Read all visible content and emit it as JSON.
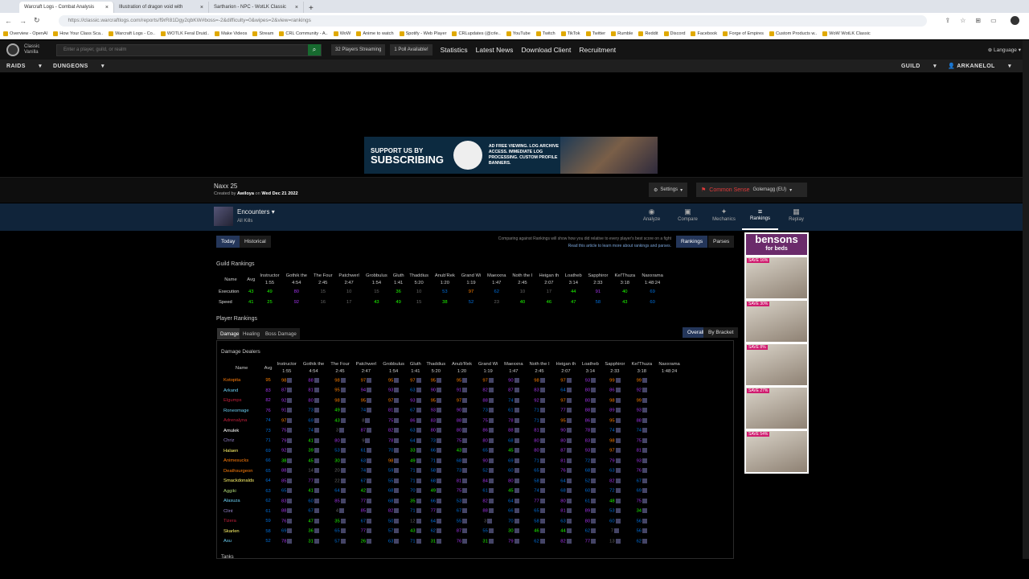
{
  "browser": {
    "tabs": [
      "Warcraft Logs - Combat Analysis",
      "Illustration of dragon void with",
      "Sartharion - NPC - WotLK Classic"
    ],
    "url": "https://classic.warcraftlogs.com/reports/f9rR81Dgy2qbKW#boss=-2&difficulty=0&wipes=2&view=rankings",
    "bookmarks": [
      "Overview - OpenAI",
      "How Your Class Sca..",
      "Warcraft Logs - Co..",
      "WOTLK Feral Druid..",
      "Make Videos",
      "Stream",
      "CRL Community - A..",
      "WoW",
      "Anime to watch",
      "Spotify - Web Player",
      "CRLupdates (@crle..",
      "YouTube",
      "Twitch",
      "TikTok",
      "Twitter",
      "Rumble",
      "Reddit",
      "Discord",
      "Facebook",
      "Forge of Empires",
      "Custom Products w..",
      "WoW WotLK Classic"
    ]
  },
  "site": {
    "version": [
      "Classic",
      "Vanilla"
    ],
    "search_placeholder": "Enter a player, guild, or realm",
    "streaming": "32 Players Streaming",
    "poll": "1 Poll Available!",
    "links": [
      "Statistics",
      "Latest News",
      "Download Client",
      "Recruitment"
    ],
    "language": "Language",
    "menu_left": [
      "RAIDS",
      "DUNGEONS"
    ],
    "menu_right": [
      "GUILD",
      "ARKANELOL"
    ]
  },
  "banner": {
    "line1": "SUPPORT US BY",
    "line2": "SUBSCRIBING",
    "features": "AD FREE VIEWING. LOG ARCHIVE ACCESS. IMMEDIATE LOG PROCESSING. CUSTOM PROFILE BANNERS."
  },
  "report": {
    "title": "Naxx 25",
    "created_prefix": "Created by",
    "creator": "Awiloya",
    "date_prefix": "on",
    "date": "Wed Dec 21 2022",
    "settings": "Settings",
    "guild": "Common Sense",
    "realm": "Golemagg (EU)",
    "encounter": "Encounters",
    "kills": "All Kills"
  },
  "report_tabs": [
    "Analyze",
    "Compare",
    "Mechanics",
    "Rankings",
    "Replay"
  ],
  "filters": {
    "today": "Today",
    "historical": "Historical",
    "rankings": "Rankings",
    "parses": "Parses",
    "compare_note": "Comparing against Rankings will show how you did relative to every player's best score on a fight",
    "compare_link": "Read this article to learn more about rankings and parses."
  },
  "guild_rankings": {
    "title": "Guild Rankings",
    "headers": [
      [
        "Name",
        ""
      ],
      [
        "Avg",
        ""
      ],
      [
        "Instructor",
        "1:55"
      ],
      [
        "Gothik the",
        "4:54"
      ],
      [
        "The Four",
        "2:45"
      ],
      [
        "Patchwerl",
        "2:47"
      ],
      [
        "Grobbulus",
        "1:54"
      ],
      [
        "Gluth",
        "1:41"
      ],
      [
        "Thaddius",
        "5:20"
      ],
      [
        "Anub'Rek",
        "1:20"
      ],
      [
        "Grand Wi",
        "1:19"
      ],
      [
        "Maexxna",
        "1:47"
      ],
      [
        "Noth the I",
        "2:45"
      ],
      [
        "Heigan th",
        "2:07"
      ],
      [
        "Loatheb",
        "3:14"
      ],
      [
        "Sapphiror",
        "2:33"
      ],
      [
        "Kel'Thuza",
        "3:18"
      ],
      [
        "Naxxrama",
        "1:48:24"
      ]
    ],
    "rows": [
      {
        "name": "Execution",
        "vals": [
          "43",
          "49",
          "80",
          "15",
          "10",
          "15",
          "36",
          "10",
          "53",
          "97",
          "62",
          "10",
          "17",
          "44",
          "91",
          "40",
          "69"
        ]
      },
      {
        "name": "Speed",
        "vals": [
          "41",
          "25",
          "92",
          "16",
          "17",
          "43",
          "49",
          "15",
          "38",
          "52",
          "23",
          "40",
          "46",
          "47",
          "58",
          "43",
          "60"
        ]
      }
    ]
  },
  "player_rankings": {
    "title": "Player Rankings",
    "tabs": [
      "Damage",
      "Healing",
      "Boss Damage"
    ],
    "modes": [
      "Overall",
      "By Bracket"
    ],
    "subtitle": "Damage Dealers",
    "next_section": "Tanks",
    "players": [
      {
        "name": "Kotopita",
        "avg": "95",
        "vals": [
          "98",
          "88",
          "98",
          "97",
          "95",
          "97",
          "95",
          "95",
          "97",
          "90",
          "98",
          "97",
          "93",
          "99",
          "99"
        ]
      },
      {
        "name": "Arkand",
        "avg": "83",
        "vals": [
          "87",
          "81",
          "95",
          "94",
          "93",
          "63",
          "90",
          "91",
          "82",
          "87",
          "83",
          "64",
          "80",
          "86",
          "92"
        ]
      },
      {
        "name": "Elgumps",
        "avg": "82",
        "vals": [
          "92",
          "80",
          "98",
          "95",
          "97",
          "93",
          "95",
          "97",
          "88",
          "74",
          "92",
          "97",
          "80",
          "98",
          "99"
        ]
      },
      {
        "name": "Roneomage",
        "avg": "76",
        "vals": [
          "91",
          "73",
          "49",
          "74",
          "81",
          "67",
          "93",
          "90",
          "73",
          "61",
          "71",
          "77",
          "88",
          "89",
          "93"
        ]
      },
      {
        "name": "Adrenalyna",
        "avg": "74",
        "vals": [
          "97",
          "69",
          "43",
          "8",
          "75",
          "86",
          "83",
          "88",
          "75",
          "78",
          "71",
          "95",
          "86",
          "95",
          "88"
        ]
      },
      {
        "name": "Amulek",
        "avg": "73",
        "vals": [
          "75",
          "74",
          "3",
          "87",
          "82",
          "63",
          "80",
          "80",
          "86",
          "88",
          "81",
          "90",
          "78",
          "74",
          "74"
        ]
      },
      {
        "name": "Chriz",
        "avg": "71",
        "vals": [
          "79",
          "41",
          "80",
          "9",
          "78",
          "64",
          "73",
          "75",
          "80",
          "68",
          "80",
          "80",
          "83",
          "98",
          "75"
        ]
      },
      {
        "name": "Halaen",
        "avg": "69",
        "vals": [
          "92",
          "39",
          "53",
          "61",
          "70",
          "33",
          "66",
          "43",
          "65",
          "45",
          "80",
          "87",
          "93",
          "97",
          "81"
        ]
      },
      {
        "name": "Animesucks",
        "avg": "66",
        "vals": [
          "38",
          "45",
          "30",
          "63",
          "98",
          "49",
          "71",
          "68",
          "90",
          "69",
          "71",
          "81",
          "72",
          "79",
          "93"
        ]
      },
      {
        "name": "Deathsurgeon",
        "avg": "65",
        "vals": [
          "88",
          "14",
          "20",
          "74",
          "59",
          "71",
          "58",
          "73",
          "52",
          "60",
          "65",
          "76",
          "68",
          "63",
          "76"
        ]
      },
      {
        "name": "Smackdonalds",
        "avg": "64",
        "vals": [
          "85",
          "77",
          "22",
          "67",
          "55",
          "71",
          "68",
          "81",
          "84",
          "80",
          "58",
          "64",
          "52",
          "82",
          "67"
        ]
      },
      {
        "name": "Aggiki",
        "avg": "63",
        "vals": [
          "65",
          "41",
          "64",
          "42",
          "68",
          "70",
          "49",
          "75",
          "61",
          "45",
          "74",
          "68",
          "60",
          "72",
          "69"
        ]
      },
      {
        "name": "Alasuza",
        "avg": "62",
        "vals": [
          "83",
          "60",
          "85",
          "77",
          "68",
          "35",
          "66",
          "53",
          "82",
          "64",
          "77",
          "80",
          "61",
          "48",
          "75"
        ]
      },
      {
        "name": "Clint",
        "avg": "61",
        "vals": [
          "88",
          "67",
          "4",
          "85",
          "82",
          "71",
          "77",
          "67",
          "88",
          "66",
          "65",
          "81",
          "89",
          "53",
          "34"
        ]
      },
      {
        "name": "Tizera",
        "avg": "59",
        "vals": [
          "76",
          "47",
          "35",
          "67",
          "50",
          "12",
          "64",
          "55",
          "3",
          "70",
          "58",
          "63",
          "80",
          "60",
          "56"
        ]
      },
      {
        "name": "Skarlen",
        "avg": "58",
        "vals": [
          "69",
          "36",
          "65",
          "77",
          "57",
          "43",
          "62",
          "87",
          "55",
          "30",
          "46",
          "44",
          "62",
          "7",
          "56"
        ]
      },
      {
        "name": "Asu",
        "avg": "52",
        "vals": [
          "78",
          "31",
          "57",
          "26",
          "63",
          "71",
          "31",
          "76",
          "31",
          "79",
          "62",
          "82",
          "77",
          "13",
          "62"
        ]
      }
    ]
  },
  "ad": {
    "brand": "bensons",
    "brand_sub": "for beds",
    "badges": [
      "SAVE 16%",
      "SAVE 30%",
      "SAVE 8%",
      "SAVE 27%",
      "SAVE 54%"
    ]
  },
  "colors": {
    "legendary": "#ff8000",
    "epic": "#a335ee",
    "rare": "#0070dd",
    "uncommon": "#1eff00",
    "gray": "#666666"
  }
}
